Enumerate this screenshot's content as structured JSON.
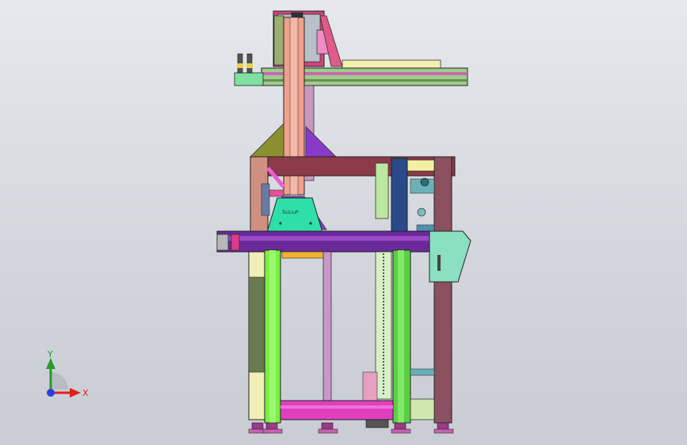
{
  "viewport": {
    "colors": {
      "bg_top": "#e6e8ec",
      "bg_bottom": "#c9cdd3"
    }
  },
  "model": {
    "engraving_text": "TuiLiuP"
  },
  "triad": {
    "y_label": "Y",
    "x_label": "X",
    "colors": {
      "x": "#e02020",
      "y": "#2a9a2a",
      "z": "#2a3ee0"
    }
  }
}
